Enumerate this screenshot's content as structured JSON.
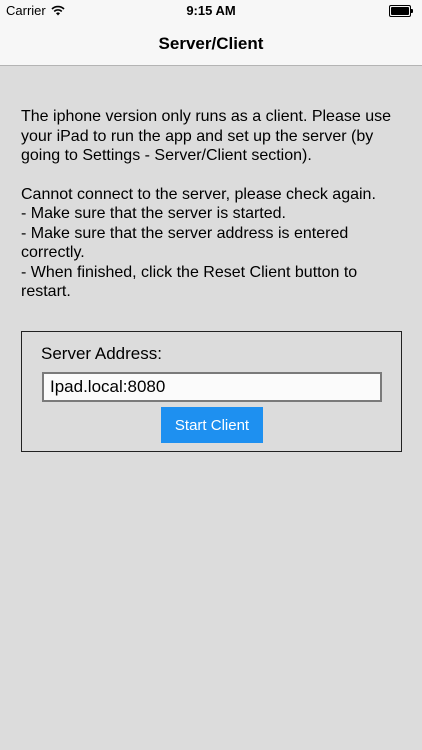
{
  "status_bar": {
    "carrier": "Carrier",
    "time": "9:15 AM",
    "wifi_icon": "wifi-icon",
    "battery_icon": "battery-icon",
    "battery_level": 1.0
  },
  "nav": {
    "title": "Server/Client"
  },
  "info": {
    "paragraph1": "The iphone version only runs as a client. Please use your iPad to run the app and set up the server (by going to Settings - Server/Client section).",
    "paragraph2": "Cannot connect to the server, please check again.\n - Make sure that the server is started.\n - Make sure that the server address is entered correctly.\n - When finished, click the Reset Client button to restart."
  },
  "server": {
    "label": "Server Address:",
    "address_value": "Ipad.local:8080",
    "start_button_label": "Start Client"
  },
  "colors": {
    "background": "#dcdcdc",
    "nav_background": "#f7f7f7",
    "button": "#1e90f0"
  }
}
